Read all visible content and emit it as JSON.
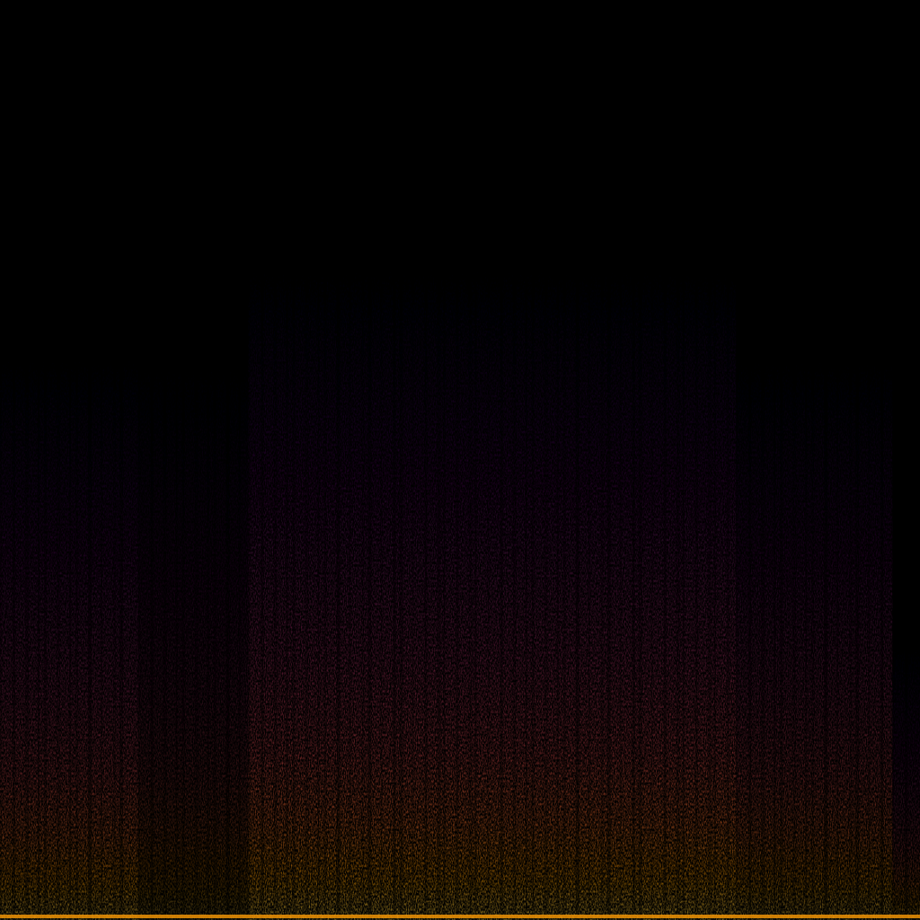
{
  "image": {
    "kind": "spectrogram",
    "colormap": "inferno",
    "background": "#000000",
    "palette": [
      "#000004",
      "#1b0c41",
      "#4a0c6b",
      "#781c6d",
      "#a52c60",
      "#cf4446",
      "#ed6925",
      "#fb9b06",
      "#f7d13d",
      "#fcffa4"
    ],
    "segments": [
      {
        "start": 0.0,
        "end": 0.15,
        "top": 0.35,
        "energy": 0.9
      },
      {
        "start": 0.15,
        "end": 0.27,
        "top": 0.35,
        "energy": 0.55
      },
      {
        "start": 0.27,
        "end": 0.53,
        "top": 0.25,
        "energy": 1.0
      },
      {
        "start": 0.53,
        "end": 0.8,
        "top": 0.25,
        "energy": 1.0
      },
      {
        "start": 0.8,
        "end": 0.97,
        "top": 0.35,
        "energy": 0.8
      },
      {
        "start": 0.97,
        "end": 1.0,
        "top": 0.68,
        "energy": 0.6
      }
    ]
  }
}
